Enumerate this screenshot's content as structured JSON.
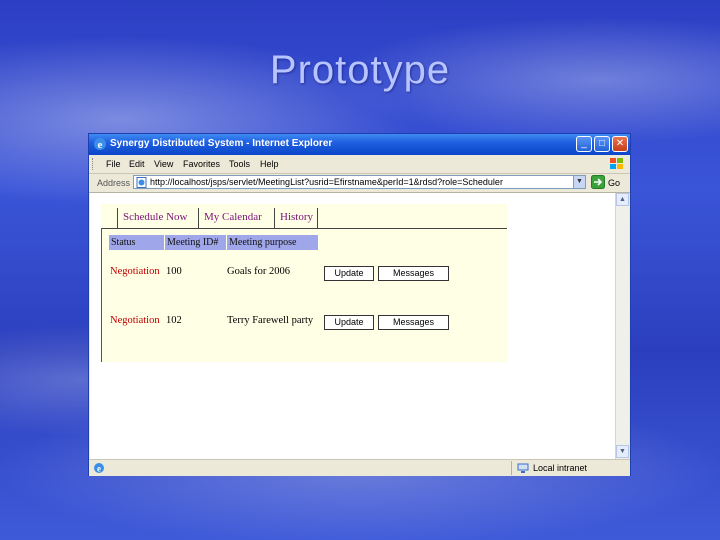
{
  "slide": {
    "title": "Prototype"
  },
  "window": {
    "title": "Synergy Distributed System - Internet Explorer",
    "controls": {
      "minimize": "_",
      "maximize": "□",
      "close": "✕"
    }
  },
  "menu": [
    "File",
    "Edit",
    "View",
    "Favorites",
    "Tools",
    "Help"
  ],
  "address": {
    "label": "Address",
    "url": "http://localhost/jsps/servlet/MeetingList?usrid=Efirstname&perId=1&rdsd?role=Scheduler",
    "go": "Go"
  },
  "status_bar": {
    "zone": "Local intranet"
  },
  "nav": [
    "Schedule Now",
    "My Calendar",
    "History"
  ],
  "table": {
    "headers": [
      "Status",
      "Meeting ID#",
      "Meeting purpose"
    ],
    "rows": [
      {
        "status": "Negotiation",
        "id": "100",
        "purpose": "Goals for 2006",
        "update": "Update",
        "messages": "Messages"
      },
      {
        "status": "Negotiation",
        "id": "102",
        "purpose": "Terry Farewell party",
        "update": "Update",
        "messages": "Messages"
      }
    ]
  },
  "colors": {
    "title_bar": "#0a46c9",
    "nav_link": "#7a1178",
    "status_text": "#c00000",
    "header_bg": "#9fa6ea",
    "page_bg": "#ffffe6"
  }
}
